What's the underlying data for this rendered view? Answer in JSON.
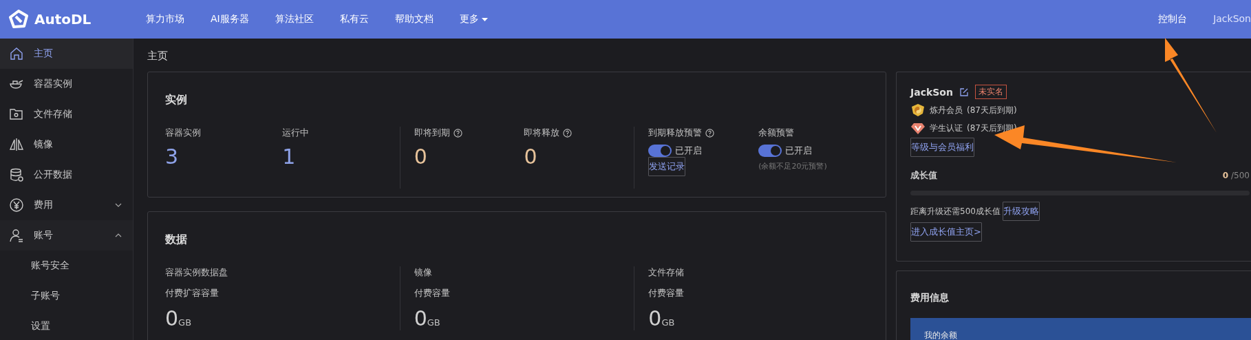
{
  "nav": {
    "logo": "AutoDL",
    "links": [
      {
        "label": "算力市场",
        "dropdown": false
      },
      {
        "label": "AI服务器",
        "dropdown": false
      },
      {
        "label": "算法社区",
        "dropdown": false
      },
      {
        "label": "私有云",
        "dropdown": false
      },
      {
        "label": "帮助文档",
        "dropdown": false
      },
      {
        "label": "更多",
        "dropdown": true
      }
    ],
    "right": [
      {
        "label": "控制台"
      },
      {
        "label": "JackSon"
      }
    ]
  },
  "sidebar": {
    "items": [
      {
        "label": "主页",
        "selected": true
      },
      {
        "label": "容器实例",
        "selected": false
      },
      {
        "label": "文件存储",
        "selected": false
      },
      {
        "label": "镜像",
        "selected": false
      },
      {
        "label": "公开数据",
        "selected": false
      },
      {
        "label": "费用",
        "selected": false,
        "expanded": false
      },
      {
        "label": "账号",
        "selected": false,
        "expanded": true,
        "children": [
          {
            "label": "账号安全",
            "selected": false
          },
          {
            "label": "子账号",
            "selected": false
          },
          {
            "label": "设置",
            "selected": false
          }
        ]
      }
    ]
  },
  "page_title": "主页",
  "instances": {
    "title": "实例",
    "stats": [
      {
        "label": "容器实例",
        "help": false,
        "value": "3",
        "kind": "count"
      },
      {
        "label": "运行中",
        "help": false,
        "value": "1",
        "kind": "count"
      },
      {
        "label": "即将到期",
        "help": true,
        "value": "0",
        "kind": "warning"
      },
      {
        "label": "即将释放",
        "help": true,
        "value": "0",
        "kind": "warning"
      }
    ],
    "alerts": [
      {
        "label": "到期释放预警",
        "help": true,
        "on": true,
        "status": "已开启",
        "button": "发送记录"
      },
      {
        "label": "余额预警",
        "help": false,
        "on": true,
        "status": "已开启",
        "note": "(余额不足20元预警)"
      }
    ]
  },
  "data": {
    "title": "数据",
    "columns": [
      {
        "label": "容器实例数据盘",
        "sublabel": "付费扩容容量",
        "value": "0",
        "unit": "GB"
      },
      {
        "label": "镜像",
        "sublabel": "付费容量",
        "value": "0",
        "unit": "GB"
      },
      {
        "label": "文件存储",
        "sublabel": "付费容量",
        "value": "0",
        "unit": "GB"
      }
    ]
  },
  "profile": {
    "name": "JackSon",
    "badge": "未实名",
    "memberships": [
      {
        "kind": "member",
        "label": "炼丹会员",
        "expiry": "(87天后到期)"
      },
      {
        "kind": "student",
        "label": "学生认证",
        "expiry": "(87天后到期)"
      }
    ],
    "benefits_link": "等级与会员福利",
    "growth": {
      "label": "成长值",
      "current": "0",
      "total": "/500",
      "level": 0
    },
    "upgrade_text": "距离升级还需500成长值",
    "upgrade_link": "升级攻略",
    "home_link": "进入成长值主页>"
  },
  "fees": {
    "title": "费用信息",
    "balance_label": "我的余额"
  }
}
